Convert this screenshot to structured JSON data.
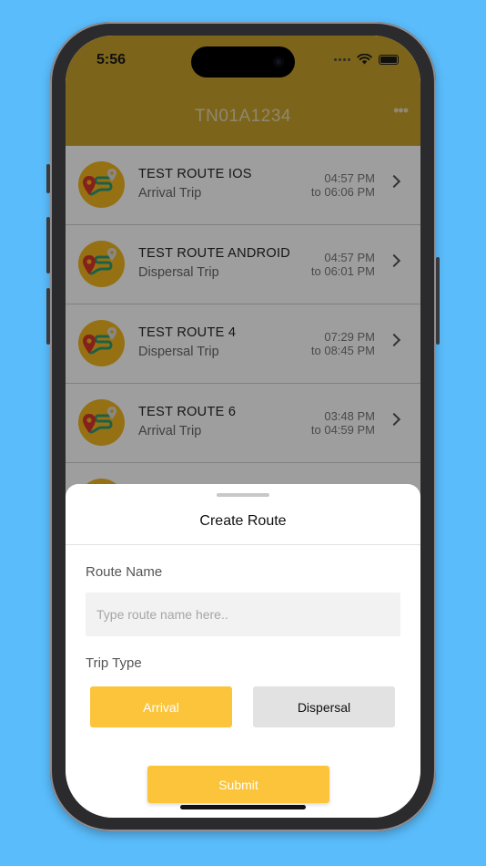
{
  "status_bar": {
    "time": "5:56"
  },
  "header": {
    "title": "TN01A1234",
    "more_label": "•••"
  },
  "routes": [
    {
      "name": "TEST ROUTE IOS",
      "trip_type": "Arrival Trip",
      "start_time": "04:57 PM",
      "end_time": "to 06:06 PM"
    },
    {
      "name": "TEST ROUTE ANDROID",
      "trip_type": "Dispersal Trip",
      "start_time": "04:57 PM",
      "end_time": "to 06:01 PM"
    },
    {
      "name": "TEST ROUTE 4",
      "trip_type": "Dispersal Trip",
      "start_time": "07:29 PM",
      "end_time": "to 08:45 PM"
    },
    {
      "name": "TEST ROUTE 6",
      "trip_type": "Arrival Trip",
      "start_time": "03:48 PM",
      "end_time": "to 04:59 PM"
    }
  ],
  "sheet": {
    "title": "Create Route",
    "route_name_label": "Route Name",
    "route_name_value": "",
    "route_name_placeholder": "Type route name here..",
    "trip_type_label": "Trip Type",
    "trip_options": [
      "Arrival",
      "Dispersal"
    ],
    "selected_trip": "Arrival",
    "submit_label": "Submit"
  },
  "colors": {
    "background": "#5ABCFB",
    "header": "#c9a22a",
    "accent": "#fbc43b",
    "route_icon": "#f2b720",
    "pin_red": "#d9352b",
    "path_green": "#2f9b74"
  },
  "icons": [
    "route-map-icon",
    "chevron-right-icon",
    "more-icon",
    "wifi-icon",
    "battery-icon"
  ]
}
